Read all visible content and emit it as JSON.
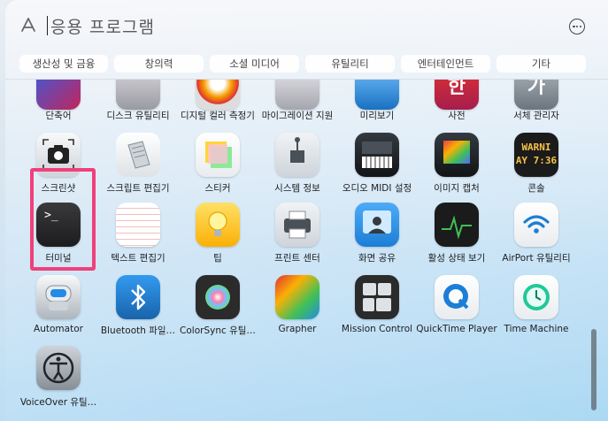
{
  "window": {
    "title": "응용 프로그램"
  },
  "tabs": [
    {
      "label": "생산성 및 금융"
    },
    {
      "label": "창의력"
    },
    {
      "label": "소셜 미디어"
    },
    {
      "label": "유틸리티"
    },
    {
      "label": "엔터테인먼트"
    },
    {
      "label": "기타"
    }
  ],
  "rows": [
    [
      {
        "label": "단축어",
        "icon": "shortcuts-icon"
      },
      {
        "label": "디스크 유틸리티",
        "icon": "disk-utility-icon"
      },
      {
        "label": "디지털 컬러 측정기",
        "icon": "color-meter-icon"
      },
      {
        "label": "마이그레이션 지원",
        "icon": "migration-icon"
      },
      {
        "label": "미리보기",
        "icon": "preview-icon"
      },
      {
        "label": "사전",
        "icon": "dictionary-icon",
        "glyph": "한"
      },
      {
        "label": "서체 관리자",
        "icon": "font-book-icon",
        "glyph": "가"
      }
    ],
    [
      {
        "label": "스크린샷",
        "icon": "screenshot-icon"
      },
      {
        "label": "스크립트 편집기",
        "icon": "script-editor-icon"
      },
      {
        "label": "스티커",
        "icon": "stickies-icon"
      },
      {
        "label": "시스템 정보",
        "icon": "system-info-icon"
      },
      {
        "label": "오디오 MIDI 설정",
        "icon": "audio-midi-icon"
      },
      {
        "label": "이미지 캡처",
        "icon": "image-capture-icon"
      },
      {
        "label": "콘솔",
        "icon": "console-icon",
        "glyph_line1": "WARNI",
        "glyph_line2": "AY 7:36"
      }
    ],
    [
      {
        "label": "터미널",
        "icon": "terminal-icon",
        "glyph": ">_"
      },
      {
        "label": "텍스트 편집기",
        "icon": "textedit-icon"
      },
      {
        "label": "팁",
        "icon": "tips-icon"
      },
      {
        "label": "프린트 센터",
        "icon": "print-center-icon"
      },
      {
        "label": "화면 공유",
        "icon": "screen-sharing-icon"
      },
      {
        "label": "활성 상태 보기",
        "icon": "activity-monitor-icon"
      },
      {
        "label": "AirPort 유틸리티",
        "icon": "airport-icon"
      }
    ],
    [
      {
        "label": "Automator",
        "icon": "automator-icon"
      },
      {
        "label": "Bluetooth 파일…",
        "icon": "bluetooth-icon"
      },
      {
        "label": "ColorSync 유틸…",
        "icon": "colorsync-icon"
      },
      {
        "label": "Grapher",
        "icon": "grapher-icon"
      },
      {
        "label": "Mission Control",
        "icon": "mission-control-icon"
      },
      {
        "label": "QuickTime Player",
        "icon": "quicktime-icon"
      },
      {
        "label": "Time Machine",
        "icon": "time-machine-icon"
      }
    ],
    [
      {
        "label": "VoiceOver 유틸…",
        "icon": "voiceover-icon"
      }
    ]
  ],
  "colors": {
    "highlight": "#f0407a"
  }
}
